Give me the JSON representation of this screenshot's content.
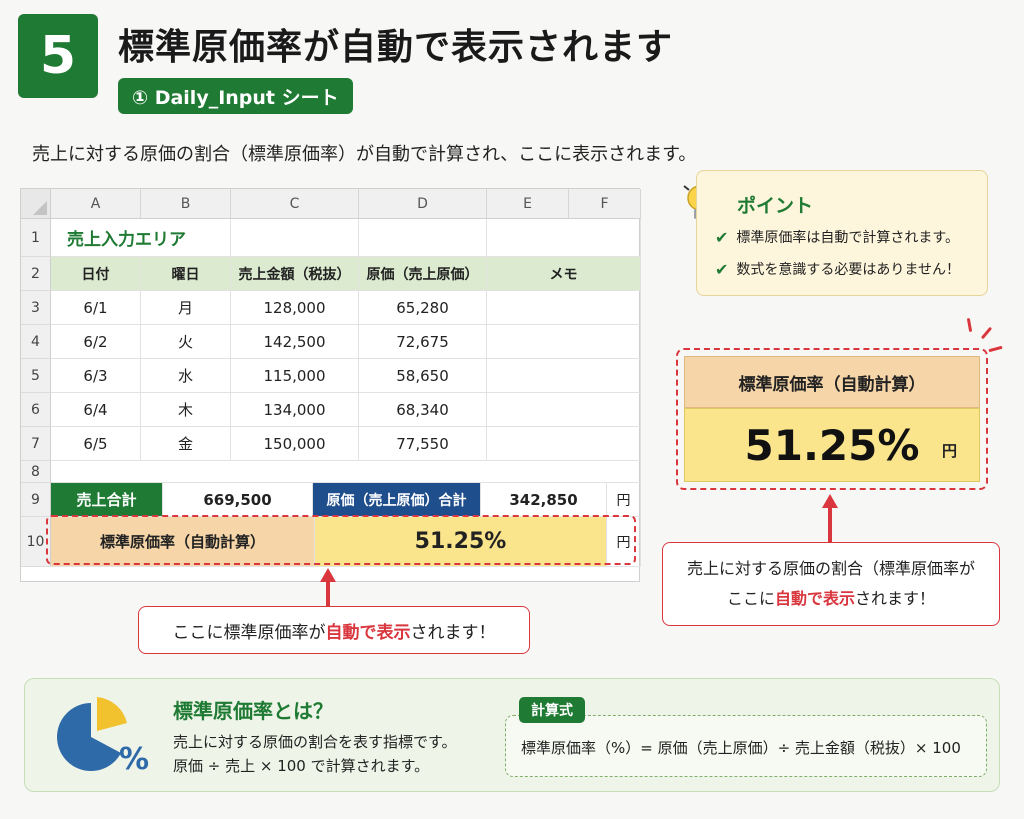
{
  "header": {
    "step_number": "5",
    "title": "標準原価率が自動で表示されます",
    "sheet_tag": "① Daily_Input シート",
    "lead": "売上に対する原価の割合（標準原価率）が自動で計算され、ここに表示されます。"
  },
  "sheet": {
    "columns": [
      "A",
      "B",
      "C",
      "D",
      "E",
      "F"
    ],
    "rows": [
      "1",
      "2",
      "3",
      "4",
      "5",
      "6",
      "7",
      "8",
      "9",
      "10"
    ],
    "area_title": "売上入力エリア",
    "headers": [
      "日付",
      "曜日",
      "売上金額（税抜）",
      "原価（売上原価）",
      "メモ"
    ],
    "data": [
      [
        "6/1",
        "月",
        "128,000",
        "65,280"
      ],
      [
        "6/2",
        "火",
        "142,500",
        "72,675"
      ],
      [
        "6/3",
        "水",
        "115,000",
        "58,650"
      ],
      [
        "6/4",
        "木",
        "134,000",
        "68,340"
      ],
      [
        "6/5",
        "金",
        "150,000",
        "77,550"
      ]
    ],
    "sales_total_label": "売上合計",
    "sales_total_value": "669,500",
    "cost_total_label": "原価（売上原価）合計",
    "cost_total_value": "342,850",
    "unit_yen": "円",
    "rate_label": "標準原価率（自動計算）",
    "rate_value": "51.25%",
    "unit_yen_2": "円"
  },
  "callout_left": {
    "prefix": "ここに標準原価率が",
    "highlight": "自動で表示",
    "suffix": "されます！"
  },
  "point": {
    "title": "ポイント",
    "items": [
      "標準原価率は自動で計算されます。",
      "数式を意識する必要はありません！"
    ]
  },
  "result": {
    "header": "標準原価率（自動計算）",
    "value": "51.25%",
    "unit": "円"
  },
  "callout_right": {
    "line1": "売上に対する原価の割合（標準原価率が",
    "line2_prefix": "ここに",
    "line2_highlight": "自動で表示",
    "line2_suffix": "されます！"
  },
  "info": {
    "icon": "pie-chart-percent-icon",
    "title": "標準原価率とは？",
    "line1": "売上に対する原価の割合を表す指標です。",
    "line2": "原価 ÷ 売上 × 100 で計算されます。",
    "formula_tag": "計算式",
    "formula": "標準原価率（%）= 原価（売上原価）÷ 売上金額（税抜）× 100"
  },
  "colors": {
    "green": "#1f7a33",
    "blue": "#1f4e8c",
    "red": "#d9363e",
    "yellow": "#fbe58c",
    "peach": "#f6d6a8"
  }
}
